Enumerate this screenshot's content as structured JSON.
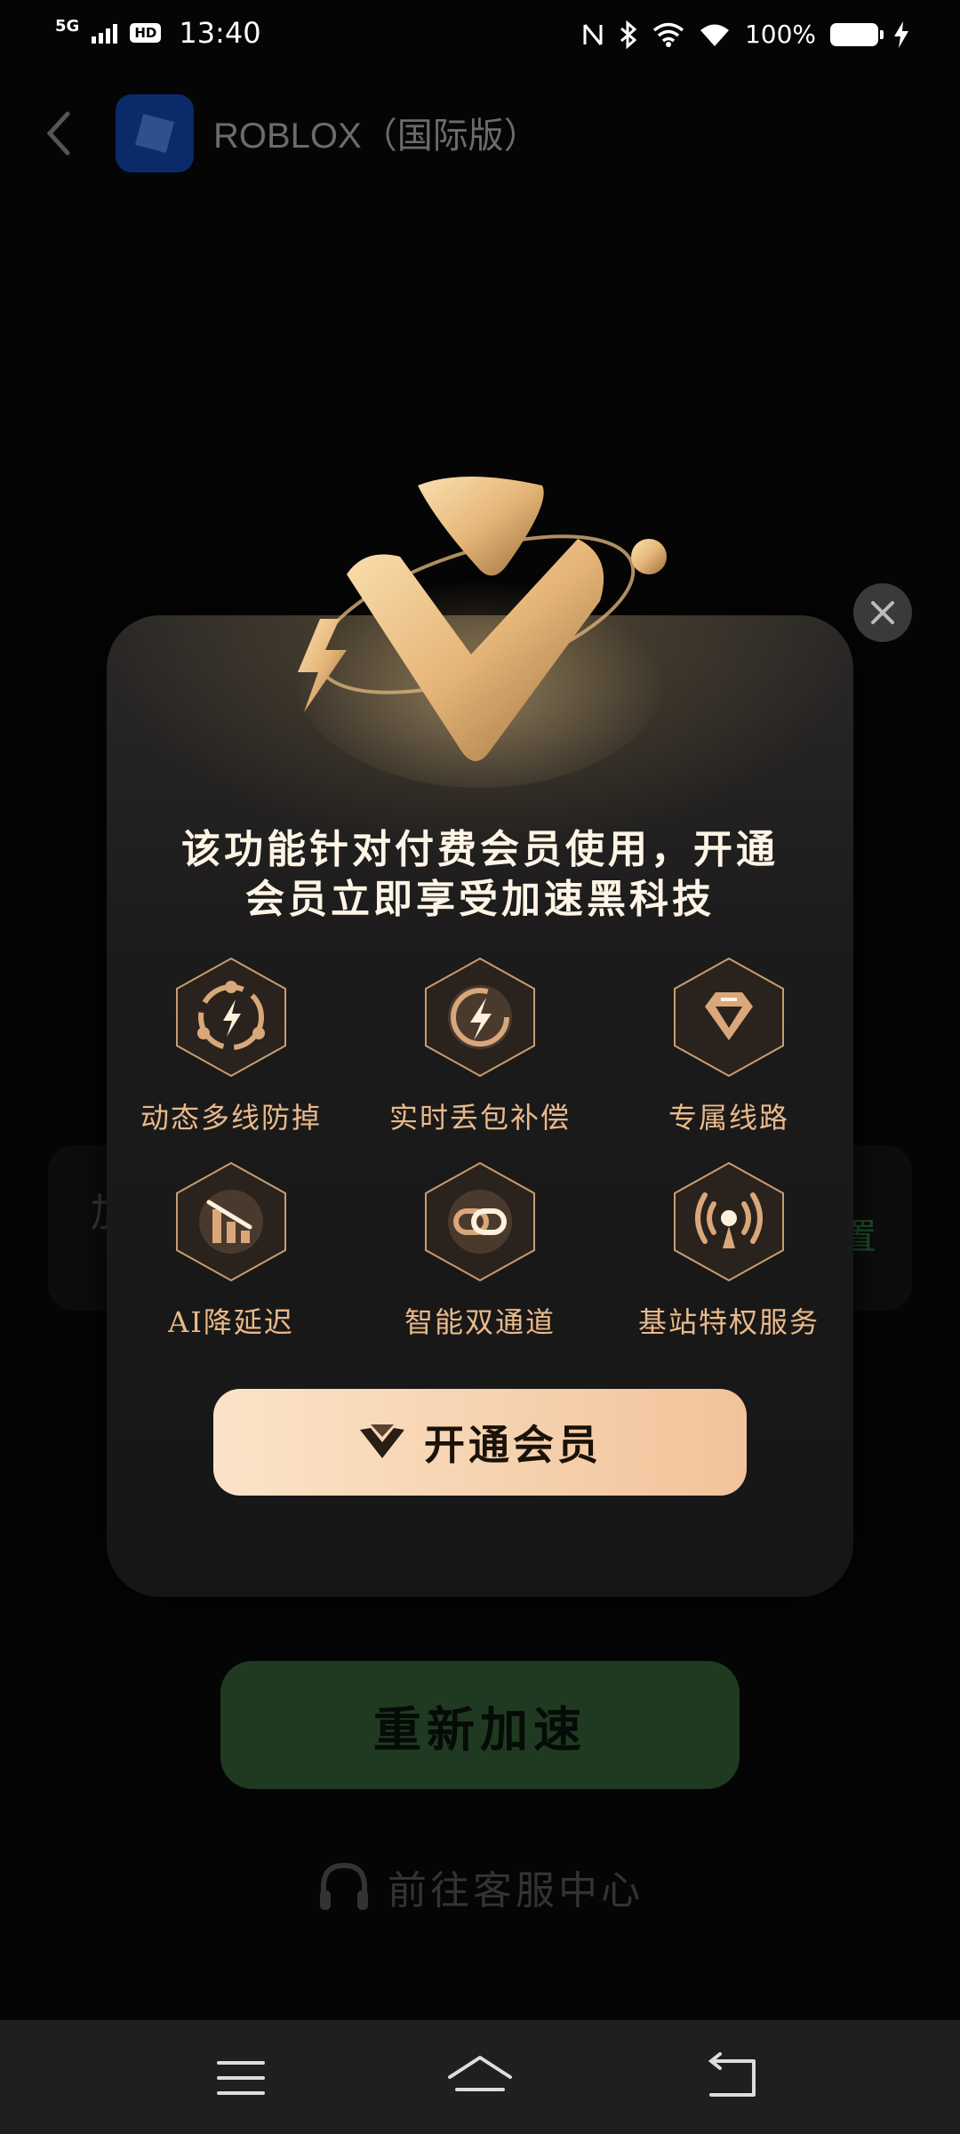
{
  "status_bar": {
    "network": "5G",
    "hd": "HD",
    "time": "13:40",
    "battery": "100%"
  },
  "header": {
    "app_title": "ROBLOX（国际版）"
  },
  "background": {
    "card_left": "加",
    "card_right": "置",
    "retry_label": "重新加速",
    "support_label": "前往客服中心"
  },
  "modal": {
    "title_line1": "该功能针对付费会员使用，开通",
    "title_line2": "会员立即享受加速黑科技",
    "features": [
      {
        "label": "动态多线防掉",
        "icon": "refresh-bolt-icon"
      },
      {
        "label": "实时丢包补偿",
        "icon": "bolt-cycle-icon"
      },
      {
        "label": "专属线路",
        "icon": "diamond-icon"
      },
      {
        "label": "AI降延迟",
        "icon": "bar-chart-down-icon"
      },
      {
        "label": "智能双通道",
        "icon": "dual-channel-icon"
      },
      {
        "label": "基站特权服务",
        "icon": "broadcast-icon"
      }
    ],
    "cta_label": "开通会员"
  },
  "colors": {
    "accent_gold": "#e9b98a",
    "cta_gradient_start": "#fbe3c8",
    "cta_gradient_end": "#f2c39a",
    "retry_green": "#203a22"
  }
}
